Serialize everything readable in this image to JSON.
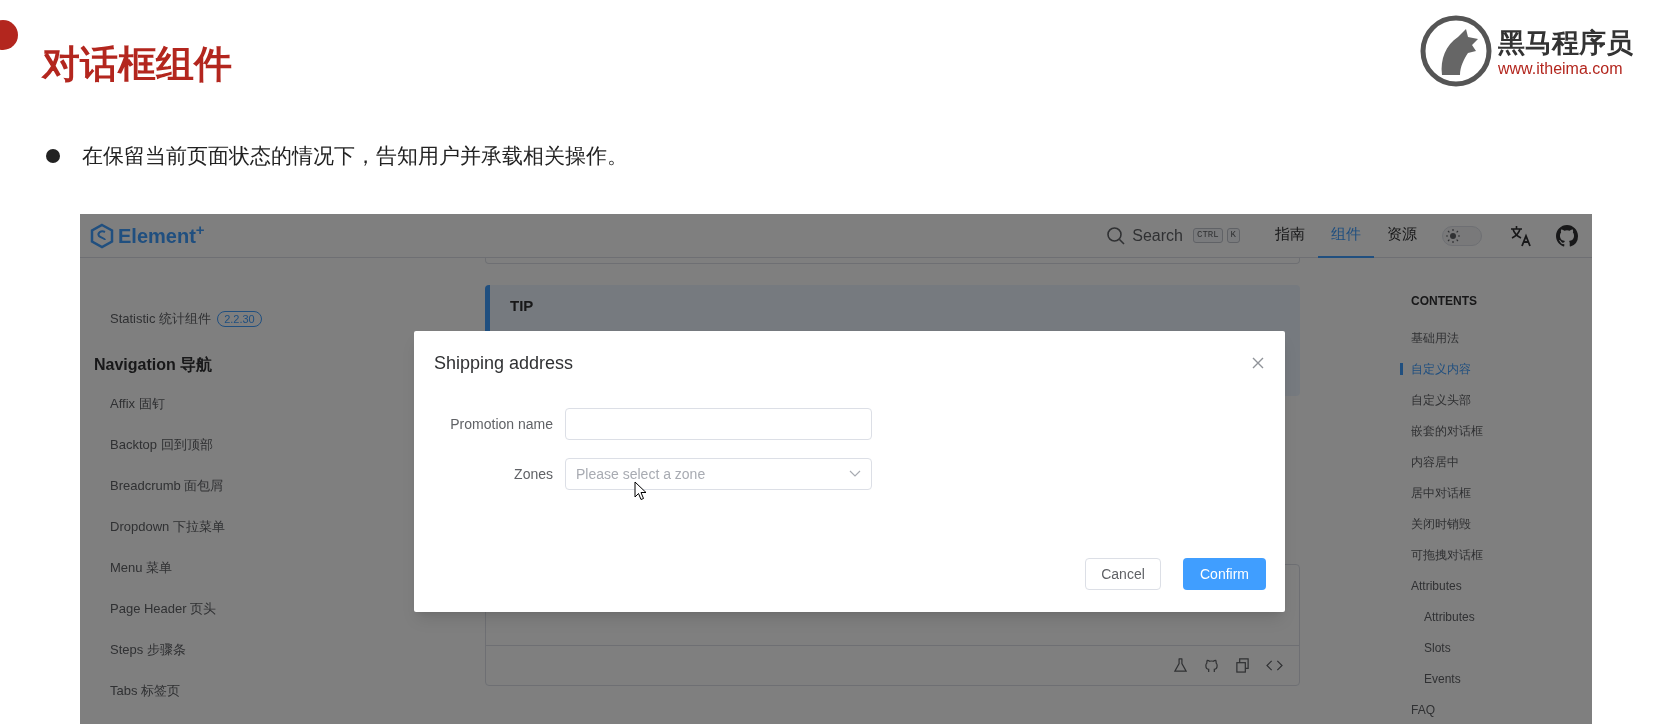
{
  "slide": {
    "title": "对话框组件",
    "bullet": "在保留当前页面状态的情况下，告知用户并承载相关操作。",
    "logo": {
      "name": "黑马程序员",
      "url": "www.itheima.com"
    }
  },
  "doc": {
    "header": {
      "brand": "Element$^{+}$",
      "search_label": "Search",
      "keys": [
        "CTRL",
        "K"
      ],
      "nav": [
        {
          "label": "指南",
          "selected": false
        },
        {
          "label": "组件",
          "selected": true
        },
        {
          "label": "资源",
          "selected": false
        }
      ],
      "dark_mode": false
    },
    "sidebar": [
      {
        "kind": "item",
        "label": "Statistic 统计组件",
        "badge": "2.2.30"
      },
      {
        "kind": "heading",
        "label": "Navigation 导航"
      },
      {
        "kind": "item",
        "label": "Affix 固钉"
      },
      {
        "kind": "item",
        "label": "Backtop 回到顶部"
      },
      {
        "kind": "item",
        "label": "Breadcrumb 面包屑"
      },
      {
        "kind": "item",
        "label": "Dropdown 下拉菜单"
      },
      {
        "kind": "item",
        "label": "Menu 菜单"
      },
      {
        "kind": "item",
        "label": "Page Header 页头"
      },
      {
        "kind": "item",
        "label": "Steps 步骤条"
      },
      {
        "kind": "item",
        "label": "Tabs 标签页"
      }
    ],
    "tip": {
      "title": "TIP"
    },
    "contents": {
      "title": "CONTENTS",
      "items": [
        {
          "label": "基础用法",
          "selected": false
        },
        {
          "label": "自定义内容",
          "selected": true
        },
        {
          "label": "自定义头部",
          "selected": false
        },
        {
          "label": "嵌套的对话框",
          "selected": false
        },
        {
          "label": "内容居中",
          "selected": false
        },
        {
          "label": "居中对话框",
          "selected": false
        },
        {
          "label": "关闭时销毁",
          "selected": false
        },
        {
          "label": "可拖拽对话框",
          "selected": false
        },
        {
          "label": "Attributes",
          "selected": false,
          "children": [
            {
              "label": "Attributes",
              "selected": false
            },
            {
              "label": "Slots",
              "selected": false
            },
            {
              "label": "Events",
              "selected": false
            }
          ]
        },
        {
          "label": "FAQ",
          "selected": false
        }
      ]
    }
  },
  "dialog": {
    "title": "Shipping address",
    "fields": [
      {
        "kind": "input",
        "label": "Promotion name"
      },
      {
        "kind": "select",
        "label": "Zones",
        "placeholder": "Please select a zone"
      }
    ],
    "buttons": [
      {
        "kind": "default",
        "label": "Cancel"
      },
      {
        "kind": "primary",
        "label": "Confirm"
      }
    ]
  }
}
